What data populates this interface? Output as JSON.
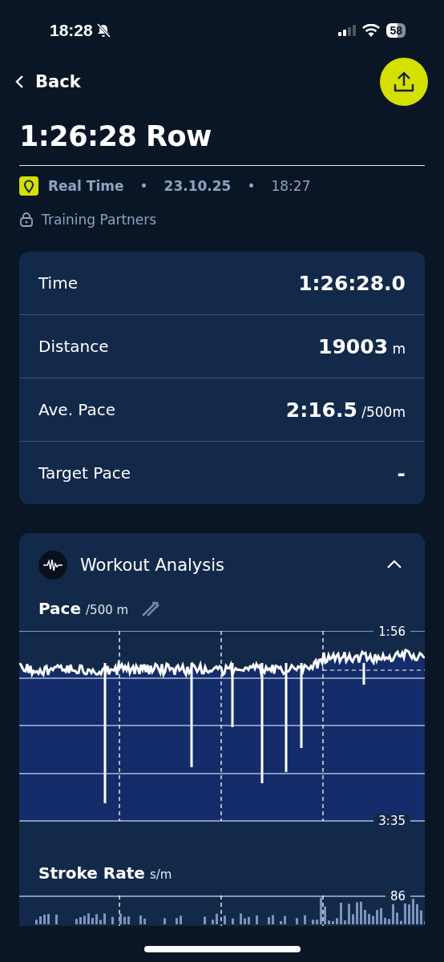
{
  "status_bar": {
    "time": "18:28",
    "battery": "58"
  },
  "nav": {
    "back": "Back"
  },
  "title": "1:26:28 Row",
  "meta": {
    "mode": "Real Time",
    "separators": [
      "•",
      "•"
    ],
    "date": "23.10.25",
    "time": "18:27",
    "privacy": "Training Partners"
  },
  "stats": [
    {
      "label": "Time",
      "value": "1:26:28.0"
    },
    {
      "label": "Distance",
      "value": "19003",
      "unit": "m"
    },
    {
      "label": "Ave. Pace",
      "value": "2:16.5",
      "unit": "/500m"
    },
    {
      "label": "Target Pace",
      "value": "-"
    }
  ],
  "analysis": {
    "title": "Workout Analysis",
    "expanded": true,
    "charts": [
      {
        "kind": "line",
        "title": "Pace",
        "unit": "/500 m",
        "top_label": "1:56",
        "bottom_label": "3:35"
      },
      {
        "kind": "bars",
        "title": "Stroke Rate",
        "unit": "s/m",
        "top_label": "86"
      }
    ]
  }
}
